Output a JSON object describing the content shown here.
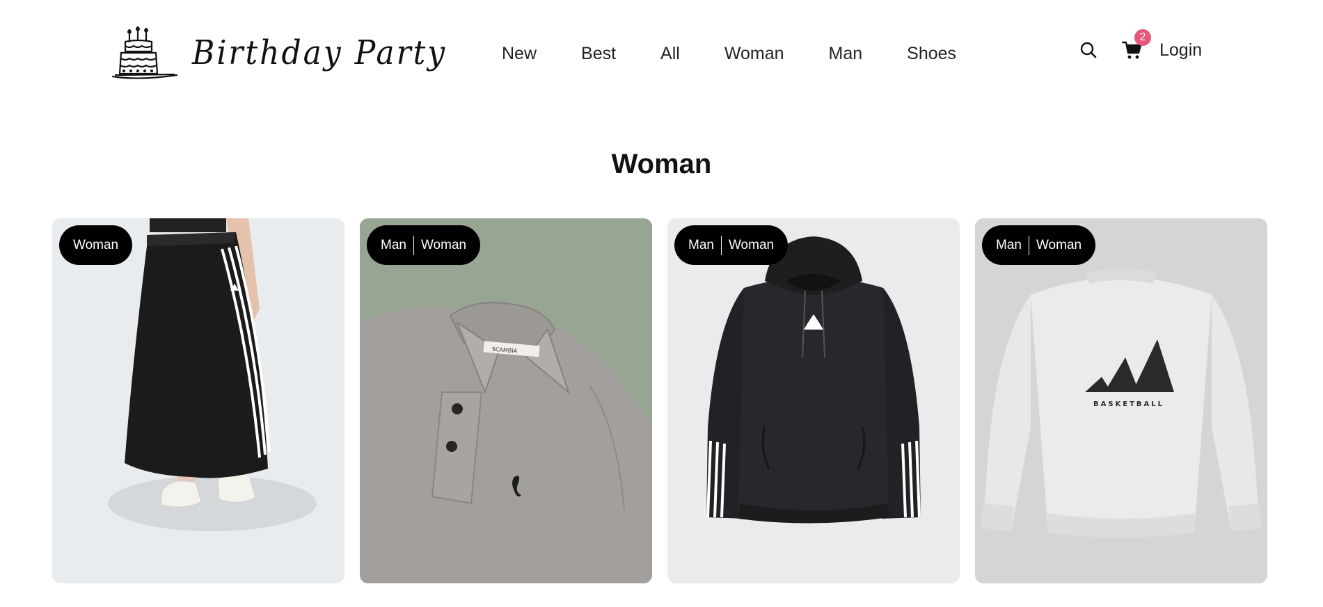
{
  "header": {
    "brand": "Birthday Party",
    "nav": [
      "New",
      "Best",
      "All",
      "Woman",
      "Man",
      "Shoes"
    ],
    "cart_count": "2",
    "login_label": "Login"
  },
  "page": {
    "title": "Woman"
  },
  "products": [
    {
      "tags": [
        "Woman"
      ],
      "image": "black-maxi-skirt",
      "background": "#e9ecee"
    },
    {
      "tags": [
        "Man",
        "Woman"
      ],
      "image": "grey-polo-shirt",
      "background": "#98a592",
      "print": "SCAMBIA"
    },
    {
      "tags": [
        "Man",
        "Woman"
      ],
      "image": "black-hoodie",
      "background": "#eaebed"
    },
    {
      "tags": [
        "Man",
        "Woman"
      ],
      "image": "white-sweatshirt",
      "background": "#d5d5d5",
      "print": "BASKETBALL"
    }
  ],
  "colors": {
    "accent_badge": "#e8557a",
    "tag_bg": "#000000"
  }
}
